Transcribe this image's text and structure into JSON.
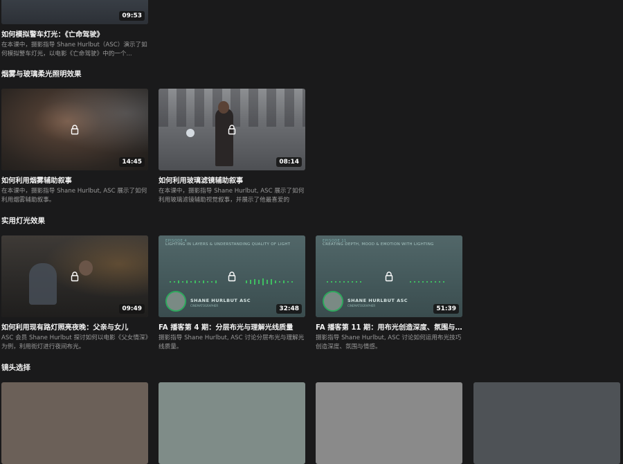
{
  "sections": [
    {
      "title": ""
    },
    {
      "title": "烟雾与玻璃柔光照明效果"
    },
    {
      "title": "实用灯光效果"
    },
    {
      "title": "镜头选择"
    }
  ],
  "cards": {
    "c0": {
      "title": "如何模拟警车灯光：《亡命驾驶》",
      "desc": "在本课中，摄影指导 Shane Hurlbut（ASC）演示了如何模拟警车灯光，以电影《亡命驾驶》中的一个...",
      "duration": "09:53"
    },
    "c1": {
      "title": "如何利用烟雾辅助叙事",
      "desc": "在本课中，摄影指导 Shane Hurlbut, ASC 展示了如何利用烟雾辅助叙事。",
      "duration": "14:45"
    },
    "c2": {
      "title": "如何利用玻璃滤镜辅助叙事",
      "desc": "在本课中，摄影指导 Shane Hurlbut, ASC 展示了如何利用玻璃滤镜辅助视觉叙事，并展示了他最喜爱的",
      "duration": "08:14"
    },
    "c3": {
      "title": "如何利用现有路灯照亮夜晚：父亲与女儿",
      "desc": "ASC 会员 Shane Hurlbut 探讨如何以电影《父女情深》为例，利用街灯进行夜间布光。",
      "duration": "09:49"
    },
    "c4": {
      "title": "FA 播客第 4 期：分层布光与理解光线质量",
      "desc": "摄影指导 Shane Hurlbut, ASC 讨论分层布光与理解光线质量。",
      "duration": "32:48",
      "episode": "EPISODE 4",
      "headline": "LIGHTING IN LAYERS & UNDERSTANDING QUALITY OF LIGHT",
      "host": "SHANE HURLBUT ASC",
      "host_sub": "CINEMATOGRAPHER"
    },
    "c5": {
      "title": "FA 播客第 11 期：用布光创造深度、氛围与...",
      "desc": "摄影指导 Shane Hurlbut, ASC 讨论如何运用布光技巧创造深度、氛围与情感。",
      "duration": "51:39",
      "episode": "EPISODE 11",
      "headline": "CREATING DEPTH, MOOD & EMOTION WITH LIGHTING",
      "host": "SHANE HURLBUT ASC",
      "host_sub": "CINEMATOGRAPHER"
    }
  },
  "colors": {
    "background": "#1a1a1b",
    "accent_green": "#2ea85d"
  },
  "icons": {
    "lock": "lock-icon"
  }
}
